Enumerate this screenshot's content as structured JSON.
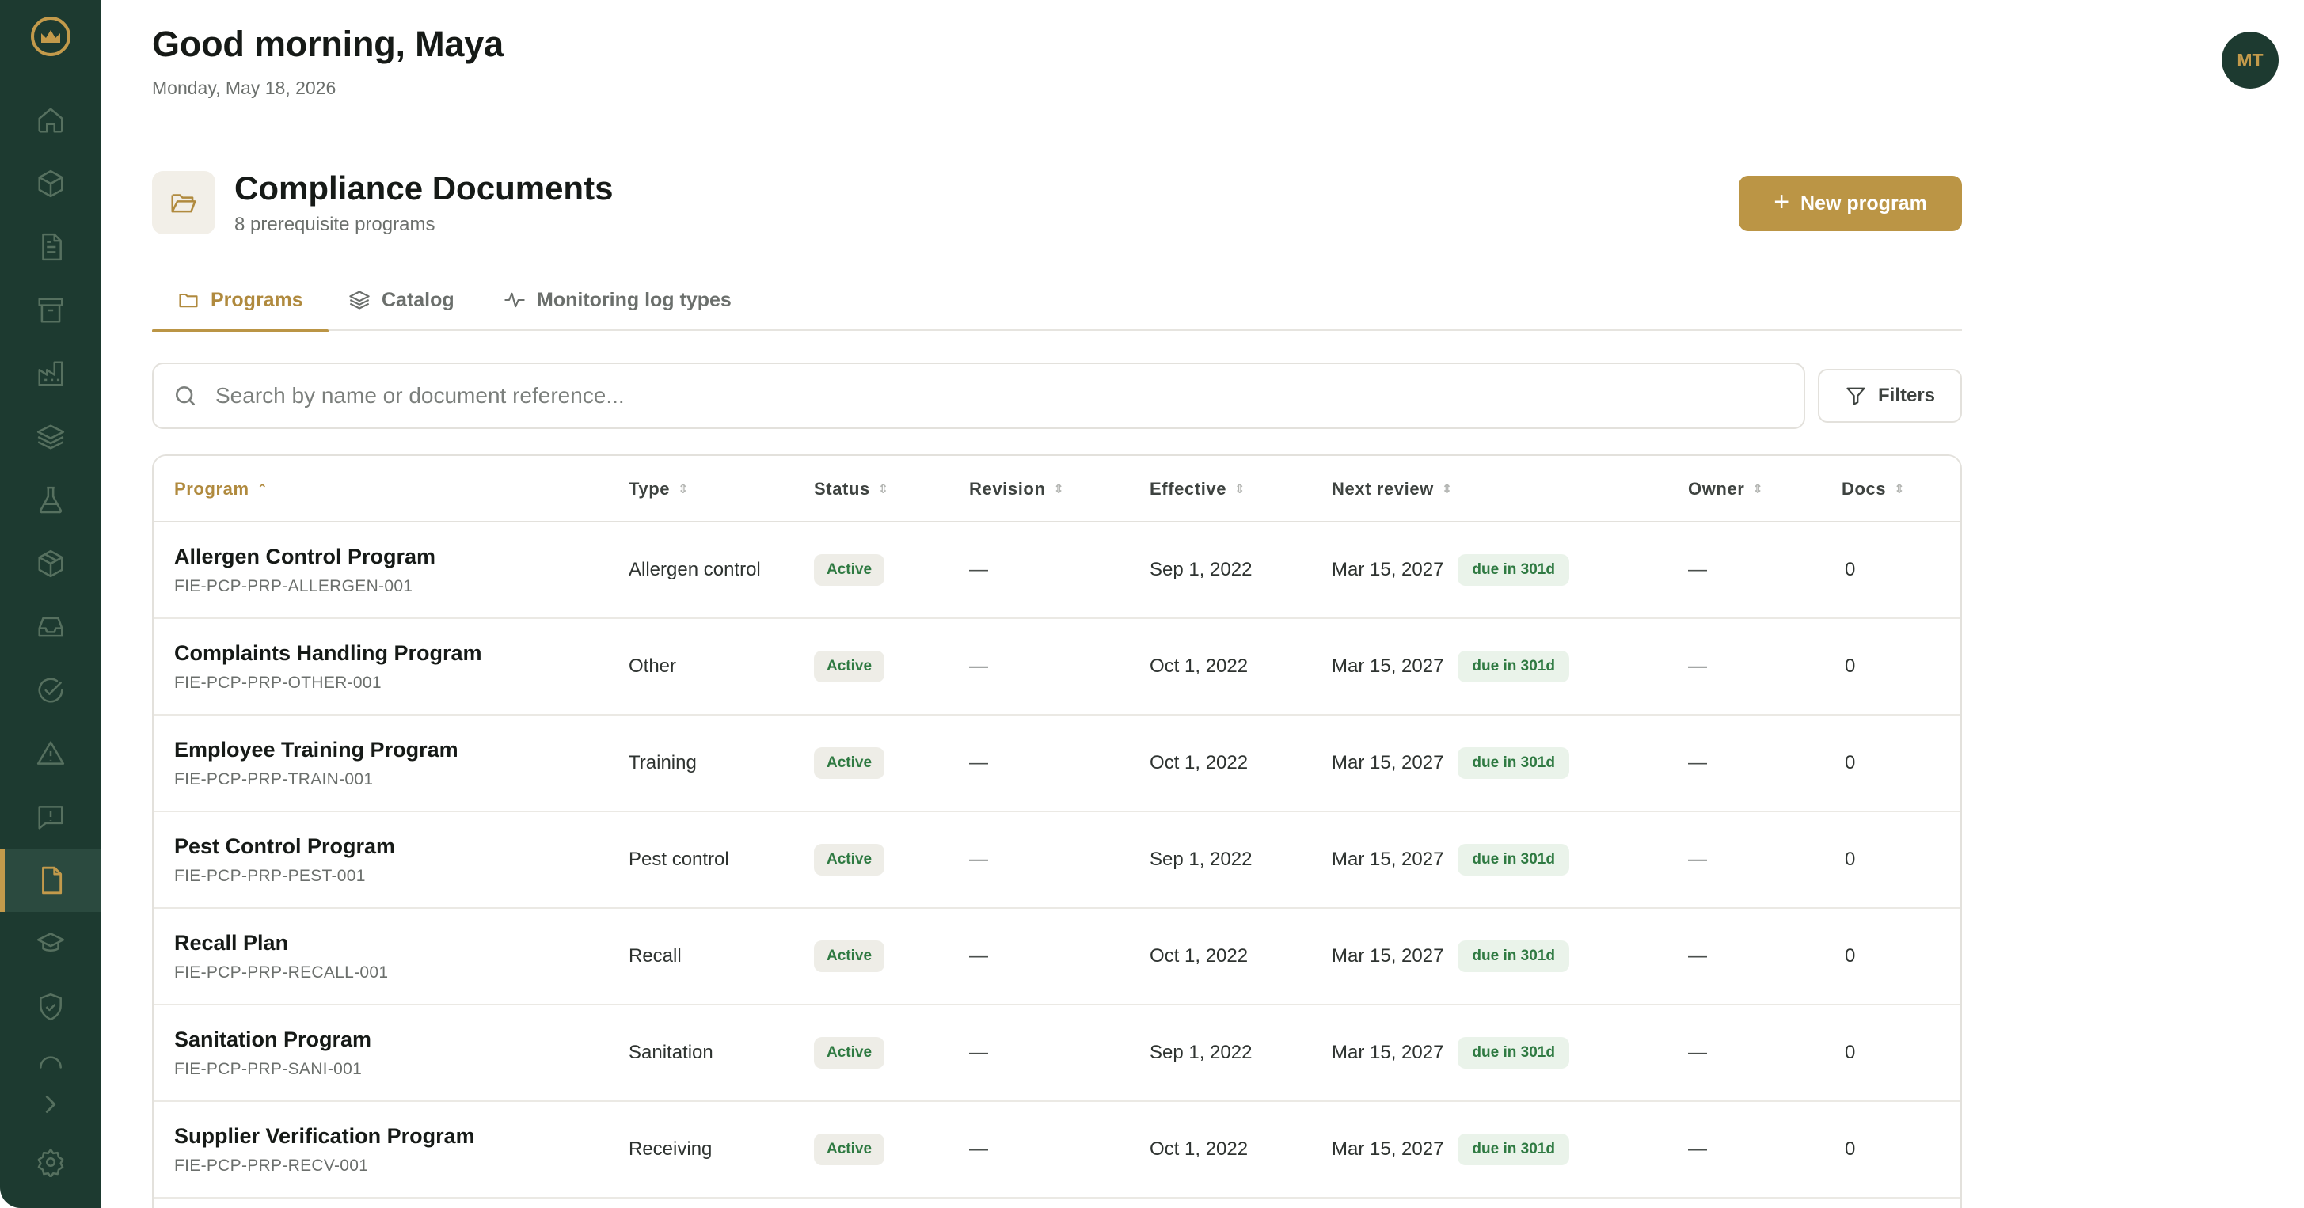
{
  "user": {
    "greeting": "Good morning, Maya",
    "date": "Monday, May 18, 2026",
    "initials": "MT"
  },
  "sidebar": {
    "items": [
      {
        "icon": "home-icon"
      },
      {
        "icon": "box-icon"
      },
      {
        "icon": "document-icon"
      },
      {
        "icon": "archive-icon"
      },
      {
        "icon": "factory-icon"
      },
      {
        "icon": "layers-icon"
      },
      {
        "icon": "flask-icon"
      },
      {
        "icon": "package-icon"
      },
      {
        "icon": "inbox-icon"
      },
      {
        "icon": "check-circle-icon"
      },
      {
        "icon": "warning-icon"
      },
      {
        "icon": "message-alert-icon"
      },
      {
        "icon": "file-icon",
        "active": true
      },
      {
        "icon": "graduation-cap-icon"
      },
      {
        "icon": "shield-check-icon"
      },
      {
        "icon": "loader-icon"
      },
      {
        "icon": "chevron-right-icon"
      },
      {
        "icon": "settings-icon"
      }
    ]
  },
  "section": {
    "title": "Compliance Documents",
    "subtitle": "8 prerequisite programs",
    "new_button": "New program",
    "icon": "folder-open-icon"
  },
  "tabs": [
    {
      "label": "Programs",
      "icon": "folder-icon",
      "active": true
    },
    {
      "label": "Catalog",
      "icon": "layers-icon",
      "active": false
    },
    {
      "label": "Monitoring log types",
      "icon": "activity-icon",
      "active": false
    }
  ],
  "search": {
    "placeholder": "Search by name or document reference...",
    "filters_label": "Filters"
  },
  "table": {
    "columns": [
      "Program",
      "Type",
      "Status",
      "Revision",
      "Effective",
      "Next review",
      "Owner",
      "Docs"
    ],
    "sorted_column": "Program",
    "rows": [
      {
        "name": "Allergen Control Program",
        "ref": "FIE-PCP-PRP-ALLERGEN-001",
        "type": "Allergen control",
        "status": "Active",
        "revision": "—",
        "effective": "Sep 1, 2022",
        "next_review": "Mar 15, 2027",
        "due": "due in 301d",
        "owner": "—",
        "docs": "0"
      },
      {
        "name": "Complaints Handling Program",
        "ref": "FIE-PCP-PRP-OTHER-001",
        "type": "Other",
        "status": "Active",
        "revision": "—",
        "effective": "Oct 1, 2022",
        "next_review": "Mar 15, 2027",
        "due": "due in 301d",
        "owner": "—",
        "docs": "0"
      },
      {
        "name": "Employee Training Program",
        "ref": "FIE-PCP-PRP-TRAIN-001",
        "type": "Training",
        "status": "Active",
        "revision": "—",
        "effective": "Oct 1, 2022",
        "next_review": "Mar 15, 2027",
        "due": "due in 301d",
        "owner": "—",
        "docs": "0"
      },
      {
        "name": "Pest Control Program",
        "ref": "FIE-PCP-PRP-PEST-001",
        "type": "Pest control",
        "status": "Active",
        "revision": "—",
        "effective": "Sep 1, 2022",
        "next_review": "Mar 15, 2027",
        "due": "due in 301d",
        "owner": "—",
        "docs": "0"
      },
      {
        "name": "Recall Plan",
        "ref": "FIE-PCP-PRP-RECALL-001",
        "type": "Recall",
        "status": "Active",
        "revision": "—",
        "effective": "Oct 1, 2022",
        "next_review": "Mar 15, 2027",
        "due": "due in 301d",
        "owner": "—",
        "docs": "0"
      },
      {
        "name": "Sanitation Program",
        "ref": "FIE-PCP-PRP-SANI-001",
        "type": "Sanitation",
        "status": "Active",
        "revision": "—",
        "effective": "Sep 1, 2022",
        "next_review": "Mar 15, 2027",
        "due": "due in 301d",
        "owner": "—",
        "docs": "0"
      },
      {
        "name": "Supplier Verification Program",
        "ref": "FIE-PCP-PRP-RECV-001",
        "type": "Receiving",
        "status": "Active",
        "revision": "—",
        "effective": "Oct 1, 2022",
        "next_review": "Mar 15, 2027",
        "due": "due in 301d",
        "owner": "—",
        "docs": "0"
      }
    ]
  },
  "colors": {
    "sidebar": "#1d3a30",
    "accent": "#bb9545",
    "status_green": "#2f7a42"
  }
}
